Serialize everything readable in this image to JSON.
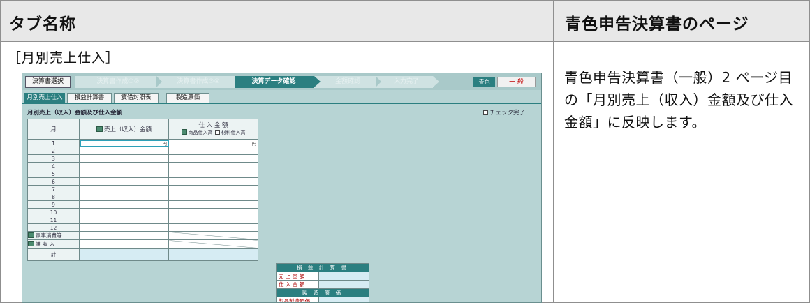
{
  "header": {
    "left_title": "タブ名称",
    "right_title": "青色申告決算書のページ"
  },
  "section_title": "［月別売上仕入］",
  "description": "青色申告決算書（一般）2 ページ目の「月別売上（収入）金額及び仕入金額」に反映します。",
  "app": {
    "select_button": "決算書選択",
    "steps": [
      "決算書作成①②",
      "決算書作成③④",
      "決算データ確認",
      "金額確認",
      "入力完了"
    ],
    "active_step_index": 2,
    "badge_blue": "青色",
    "badge_type": "一 般",
    "tabs": [
      "月別売上仕入",
      "損益計算書",
      "貸借対照表",
      "製造原価"
    ],
    "active_tab_index": 0,
    "panel_title": "月別売上（収入）金額及び仕入金額",
    "check_done": "チェック完了",
    "grid": {
      "col_month": "月",
      "col_sales": "売上（収入）金額",
      "col_purchase": "仕 入 金 額",
      "purchase_goods": "商品仕入高",
      "purchase_materials": "材料仕入高",
      "unit": "円",
      "months": [
        "1",
        "2",
        "3",
        "4",
        "5",
        "6",
        "7",
        "8",
        "9",
        "10",
        "11",
        "12"
      ],
      "household": "家事消費等",
      "misc_income": "雑 収 入",
      "total": "計"
    },
    "pl_table": {
      "title": "損 益 計 算 書",
      "sales": "売 上 金 額",
      "purchase": "仕 入 金 額",
      "mfg_title": "製 造 原 価",
      "mfg_cost": "製品製造原価"
    }
  }
}
